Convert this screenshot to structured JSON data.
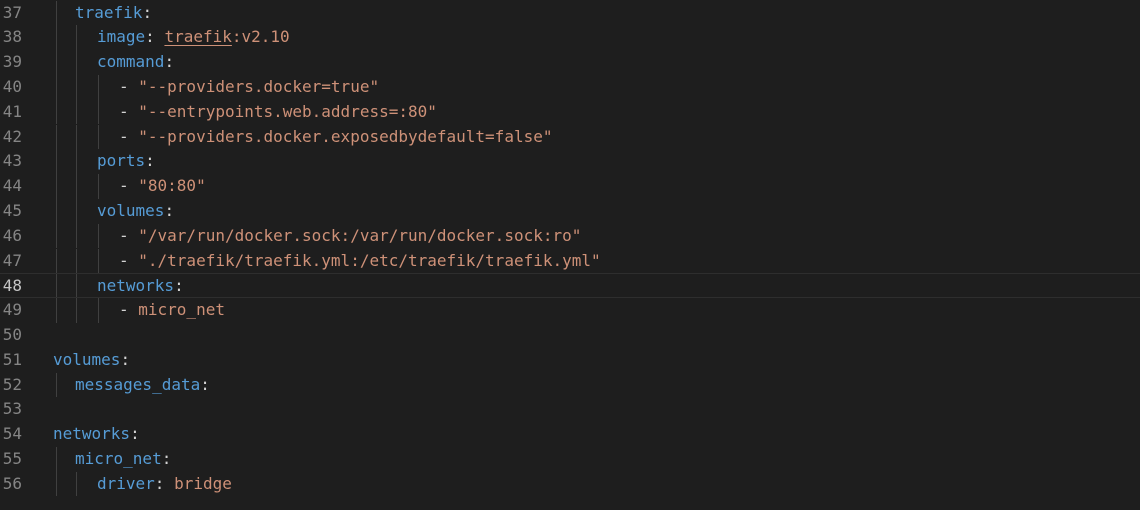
{
  "editor": {
    "language": "yaml",
    "current_line": "48",
    "lines": [
      {
        "number": "37",
        "indent": 1,
        "tokens": [
          {
            "t": "key",
            "v": "traefik"
          },
          {
            "t": "punct",
            "v": ":"
          }
        ]
      },
      {
        "number": "38",
        "indent": 2,
        "tokens": [
          {
            "t": "key",
            "v": "image"
          },
          {
            "t": "punct",
            "v": ": "
          },
          {
            "t": "link",
            "v": "traefik"
          },
          {
            "t": "plain",
            "v": ":v2.10"
          }
        ]
      },
      {
        "number": "39",
        "indent": 2,
        "tokens": [
          {
            "t": "key",
            "v": "command"
          },
          {
            "t": "punct",
            "v": ":"
          }
        ]
      },
      {
        "number": "40",
        "indent": 3,
        "tokens": [
          {
            "t": "punct",
            "v": "- "
          },
          {
            "t": "str",
            "v": "\"--providers.docker=true\""
          }
        ]
      },
      {
        "number": "41",
        "indent": 3,
        "tokens": [
          {
            "t": "punct",
            "v": "- "
          },
          {
            "t": "str",
            "v": "\"--entrypoints.web.address=:80\""
          }
        ]
      },
      {
        "number": "42",
        "indent": 3,
        "tokens": [
          {
            "t": "punct",
            "v": "- "
          },
          {
            "t": "str",
            "v": "\"--providers.docker.exposedbydefault=false\""
          }
        ]
      },
      {
        "number": "43",
        "indent": 2,
        "tokens": [
          {
            "t": "key",
            "v": "ports"
          },
          {
            "t": "punct",
            "v": ":"
          }
        ]
      },
      {
        "number": "44",
        "indent": 3,
        "tokens": [
          {
            "t": "punct",
            "v": "- "
          },
          {
            "t": "str",
            "v": "\"80:80\""
          }
        ]
      },
      {
        "number": "45",
        "indent": 2,
        "tokens": [
          {
            "t": "key",
            "v": "volumes"
          },
          {
            "t": "punct",
            "v": ":"
          }
        ]
      },
      {
        "number": "46",
        "indent": 3,
        "tokens": [
          {
            "t": "punct",
            "v": "- "
          },
          {
            "t": "str",
            "v": "\"/var/run/docker.sock:/var/run/docker.sock:ro\""
          }
        ]
      },
      {
        "number": "47",
        "indent": 3,
        "tokens": [
          {
            "t": "punct",
            "v": "- "
          },
          {
            "t": "str",
            "v": "\"./traefik/traefik.yml:/etc/traefik/traefik.yml\""
          }
        ]
      },
      {
        "number": "48",
        "indent": 2,
        "tokens": [
          {
            "t": "key",
            "v": "networks"
          },
          {
            "t": "punct",
            "v": ":"
          }
        ]
      },
      {
        "number": "49",
        "indent": 3,
        "tokens": [
          {
            "t": "punct",
            "v": "- "
          },
          {
            "t": "plain",
            "v": "micro_net"
          }
        ]
      },
      {
        "number": "50",
        "indent": 0,
        "tokens": []
      },
      {
        "number": "51",
        "indent": 0,
        "tokens": [
          {
            "t": "key",
            "v": "volumes"
          },
          {
            "t": "punct",
            "v": ":"
          }
        ]
      },
      {
        "number": "52",
        "indent": 1,
        "tokens": [
          {
            "t": "key",
            "v": "messages_data"
          },
          {
            "t": "punct",
            "v": ":"
          }
        ]
      },
      {
        "number": "53",
        "indent": 0,
        "tokens": []
      },
      {
        "number": "54",
        "indent": 0,
        "tokens": [
          {
            "t": "key",
            "v": "networks"
          },
          {
            "t": "punct",
            "v": ":"
          }
        ]
      },
      {
        "number": "55",
        "indent": 1,
        "tokens": [
          {
            "t": "key",
            "v": "micro_net"
          },
          {
            "t": "punct",
            "v": ":"
          }
        ]
      },
      {
        "number": "56",
        "indent": 2,
        "tokens": [
          {
            "t": "key",
            "v": "driver"
          },
          {
            "t": "punct",
            "v": ": "
          },
          {
            "t": "plain",
            "v": "bridge"
          }
        ]
      }
    ]
  }
}
